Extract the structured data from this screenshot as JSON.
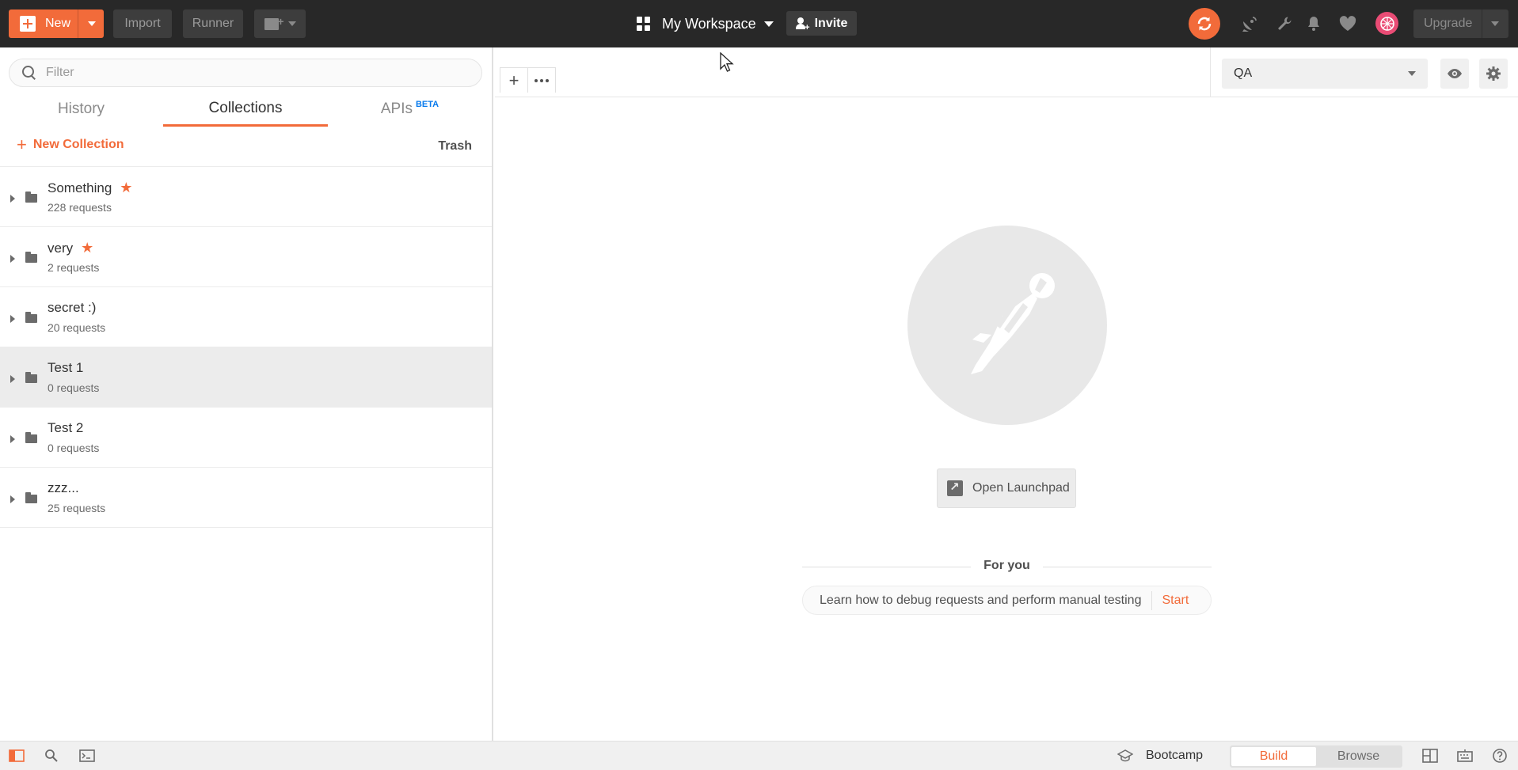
{
  "topbar": {
    "new_label": "New",
    "import_label": "Import",
    "runner_label": "Runner",
    "workspace_name": "My Workspace",
    "invite_label": "Invite",
    "upgrade_label": "Upgrade"
  },
  "sidebar": {
    "filter_placeholder": "Filter",
    "tabs": {
      "history": "History",
      "collections": "Collections",
      "apis": "APIs",
      "apis_badge": "BETA"
    },
    "active_tab": "Collections",
    "new_collection_label": "New Collection",
    "trash_label": "Trash",
    "collections": [
      {
        "name": "Something",
        "count": "228 requests",
        "starred": true
      },
      {
        "name": "very",
        "count": "2 requests",
        "starred": true
      },
      {
        "name": "secret :)",
        "count": "20 requests",
        "starred": false
      },
      {
        "name": "Test 1",
        "count": "0 requests",
        "starred": false,
        "highlighted": true
      },
      {
        "name": "Test 2",
        "count": "0 requests",
        "starred": false
      },
      {
        "name": "zzz...",
        "count": "25 requests",
        "starred": false
      }
    ]
  },
  "main": {
    "environment": "QA",
    "open_launchpad_label": "Open Launchpad",
    "for_you_label": "For you",
    "tip_text": "Learn how to debug requests and perform manual testing",
    "tip_action": "Start"
  },
  "statusbar": {
    "bootcamp_label": "Bootcamp",
    "build_label": "Build",
    "browse_label": "Browse",
    "active_mode": "Build"
  },
  "icons": {
    "new": "plus-box-icon",
    "new_window": "new-window-icon",
    "workspace": "grid-icon",
    "invite": "person-plus-icon",
    "sync": "sync-icon",
    "interceptor": "satellite-icon",
    "settings": "wrench-icon",
    "notifications": "bell-icon",
    "heart": "heart-icon",
    "user": "avatar-icon",
    "filter": "search-icon",
    "folder": "folder-icon",
    "star": "star-icon",
    "eye": "eye-icon",
    "gear": "gear-icon",
    "sidebar_toggle": "sidebar-icon",
    "find": "find-icon",
    "console": "console-icon",
    "bootcamp": "graduation-cap-icon",
    "two_pane": "two-pane-icon",
    "keyboard": "keyboard-icon",
    "help": "help-icon"
  },
  "colors": {
    "accent": "#f26b3a",
    "topbar_bg": "#282828",
    "beta_badge": "#097bed",
    "avatar": "#ea4c75"
  }
}
